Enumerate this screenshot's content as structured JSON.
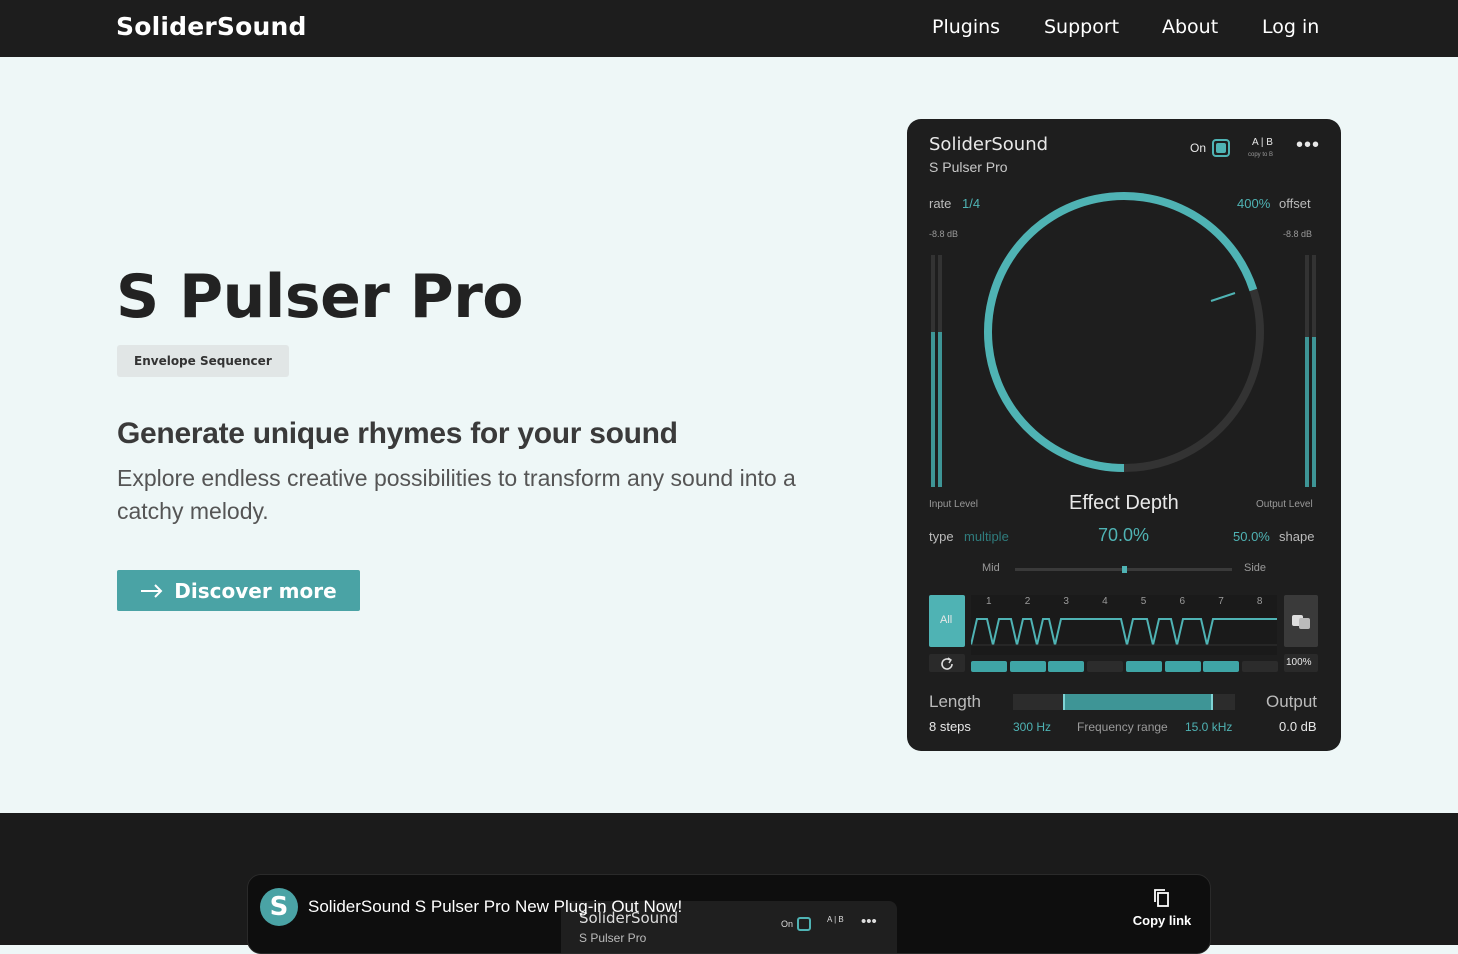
{
  "nav": {
    "brand": "SoliderSound",
    "links": [
      "Plugins",
      "Support",
      "About",
      "Log in"
    ]
  },
  "hero": {
    "title": "S Pulser Pro",
    "badge": "Envelope Sequencer",
    "subtitle": "Generate unique rhymes for your sound",
    "description": "Explore endless creative possibilities to transform any sound into a catchy melody.",
    "cta": "Discover more"
  },
  "plugin": {
    "brand": "SoliderSound",
    "product": "S Pulser Pro",
    "on_label": "On",
    "ab_label": "A | B",
    "ab_sub": "copy to B",
    "rate_label": "rate",
    "rate_value": "1/4",
    "offset_value": "400%",
    "offset_label": "offset",
    "input_db": "-8.8 dB",
    "output_db": "-8.8 dB",
    "input_level": "Input Level",
    "output_level": "Output Level",
    "effect_depth_label": "Effect Depth",
    "effect_depth_value": "70.0%",
    "effect_depth_fraction": 0.7,
    "type_label": "type",
    "type_value": "multiple",
    "shape_value": "50.0%",
    "shape_label": "shape",
    "mid_label": "Mid",
    "side_label": "Side",
    "mid_side_balance": 0.5,
    "all_label": "All",
    "steps": [
      "1",
      "2",
      "3",
      "4",
      "5",
      "6",
      "7",
      "8"
    ],
    "step_active": [
      true,
      true,
      true,
      false,
      true,
      true,
      true,
      false
    ],
    "percent": "100%",
    "length_label": "Length",
    "length_value": "8 steps",
    "freq_low": "300 Hz",
    "freq_label": "Frequency range",
    "freq_high": "15.0 kHz",
    "output_label": "Output",
    "output_value": "0.0 dB",
    "accent_color": "#4fb3b4"
  },
  "video": {
    "avatar_letter": "S",
    "title": "SoliderSound S Pulser Pro New Plug-in Out Now!",
    "thumb_brand": "SoliderSound",
    "thumb_product": "S Pulser Pro",
    "thumb_on": "On",
    "thumb_ab": "A | B",
    "copy_link": "Copy link"
  }
}
